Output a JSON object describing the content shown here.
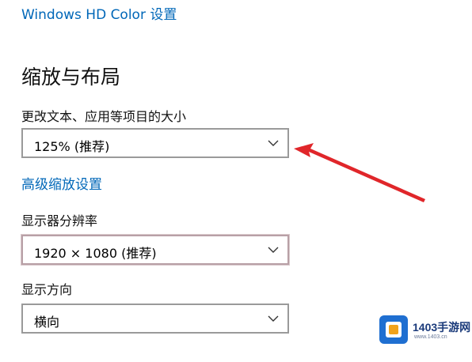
{
  "links": {
    "hd_color": "Windows HD Color 设置",
    "advanced_scaling": "高级缩放设置"
  },
  "section": {
    "title": "缩放与布局"
  },
  "scale": {
    "label": "更改文本、应用等项目的大小",
    "value": "125% (推荐)"
  },
  "resolution": {
    "label": "显示器分辨率",
    "value": "1920 × 1080 (推荐)"
  },
  "orientation": {
    "label": "显示方向",
    "value": "横向"
  },
  "watermark": {
    "brand": "1403手游网",
    "url": "www.1403.cn"
  },
  "colors": {
    "link": "#0067b8",
    "annotation_arrow": "#e0262a",
    "dropdown_border": "#9a9a9a"
  },
  "icons": {
    "dropdown": "chevron-down-icon",
    "annotation": "red-arrow-annotation",
    "watermark_logo": "watermark-logo"
  }
}
